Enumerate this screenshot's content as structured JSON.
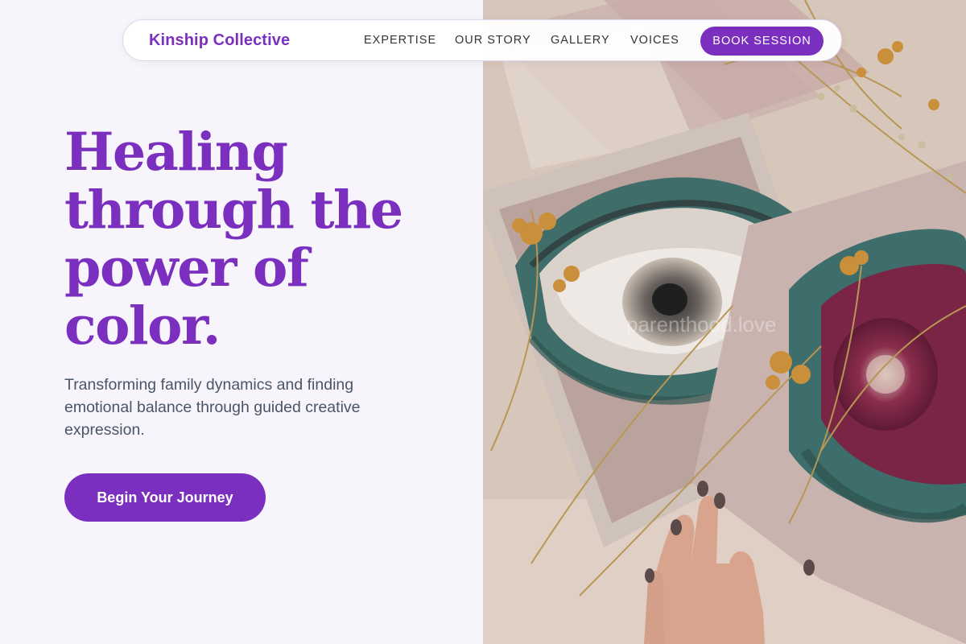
{
  "brand": {
    "name": "Kinship Collective"
  },
  "nav": {
    "links": [
      "EXPERTISE",
      "OUR STORY",
      "GALLERY",
      "VOICES"
    ],
    "cta": "BOOK SESSION"
  },
  "hero": {
    "headline_lines": [
      "Healing",
      "through the",
      "power of",
      "color."
    ],
    "subtext": "Transforming family dynamics and finding emotional balance through guided creative expression.",
    "cta": "Begin Your Journey",
    "image_watermark": "parenthood.love"
  },
  "colors": {
    "accent": "#7b2fbe",
    "background": "#f7f5fb",
    "body_text": "#4a5568",
    "nav_text": "#333333"
  }
}
